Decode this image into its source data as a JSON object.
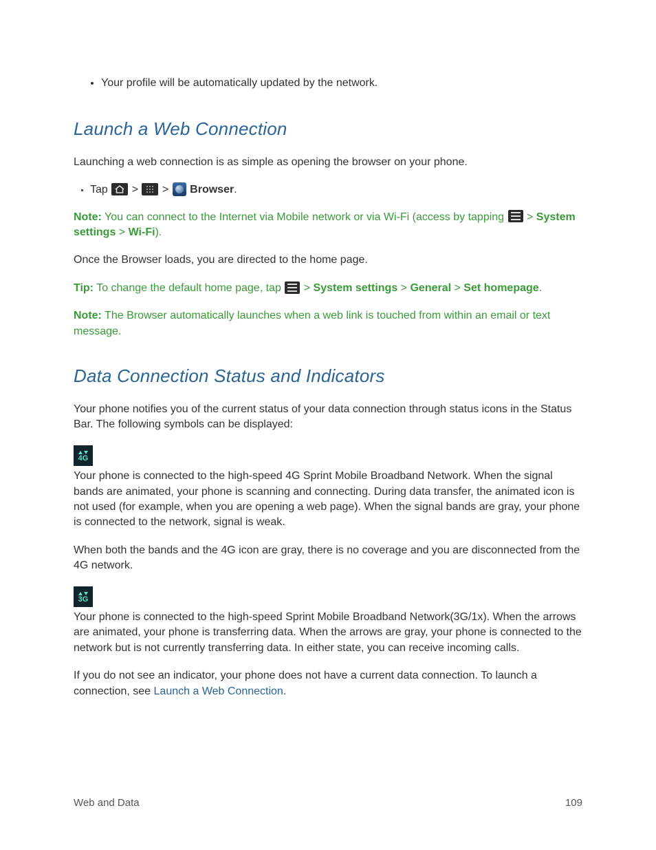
{
  "intro_bullet": "Your profile will be automatically updated by the network.",
  "heading1": "Launch a Web Connection",
  "p1": "Launching a web connection is as simple as opening the browser on your phone.",
  "tap_line": {
    "tap": "Tap ",
    "sep": " > ",
    "browser": " Browser",
    "period": "."
  },
  "note1": {
    "label": "Note:",
    "text_a": "  You can connect to the Internet via Mobile network or via Wi-Fi (access by tapping ",
    "text_sep": " > ",
    "sys": "System settings",
    "wifi": "Wi-Fi",
    "close": ")."
  },
  "p2": "Once the Browser loads, you are directed to the home page.",
  "tip": {
    "label": "Tip:",
    "text_a": "  To change the default home page, tap ",
    "sep": " > ",
    "sys": "System settings",
    "gen": "General",
    "set": "Set homepage",
    "period": "."
  },
  "note2": {
    "label": "Note:",
    "text": "  The Browser automatically launches when a web link is touched from within an email or text message."
  },
  "heading2": "Data Connection Status and Indicators",
  "p3": "Your phone notifies you of the current status of your data connection through status icons in the Status Bar. The following symbols can be displayed:",
  "icon4g_label": "4G",
  "p4": "Your phone is connected to the high-speed 4G Sprint Mobile Broadband Network. When the signal bands are animated, your phone is scanning and connecting. During data transfer, the animated icon is not used (for example, when you are opening a web page). When the signal bands are gray, your phone is connected to the network, signal is weak.",
  "p5": "When both the bands and the 4G icon are gray, there is no coverage and you are disconnected from the 4G network.",
  "icon3g_label": "3G",
  "p6": "Your phone is connected to the high-speed Sprint Mobile Broadband Network(3G/1x). When the arrows are animated, your phone is transferring data. When the arrows are gray, your phone is connected to the network but is not currently transferring data. In either state, you can receive incoming calls.",
  "p7_a": "If you do not see an indicator, your phone does not have a current data connection. To launch a connection, see ",
  "p7_link": "Launch a Web Connection",
  "p7_b": ".",
  "footer_left": "Web and Data",
  "footer_right": "109"
}
